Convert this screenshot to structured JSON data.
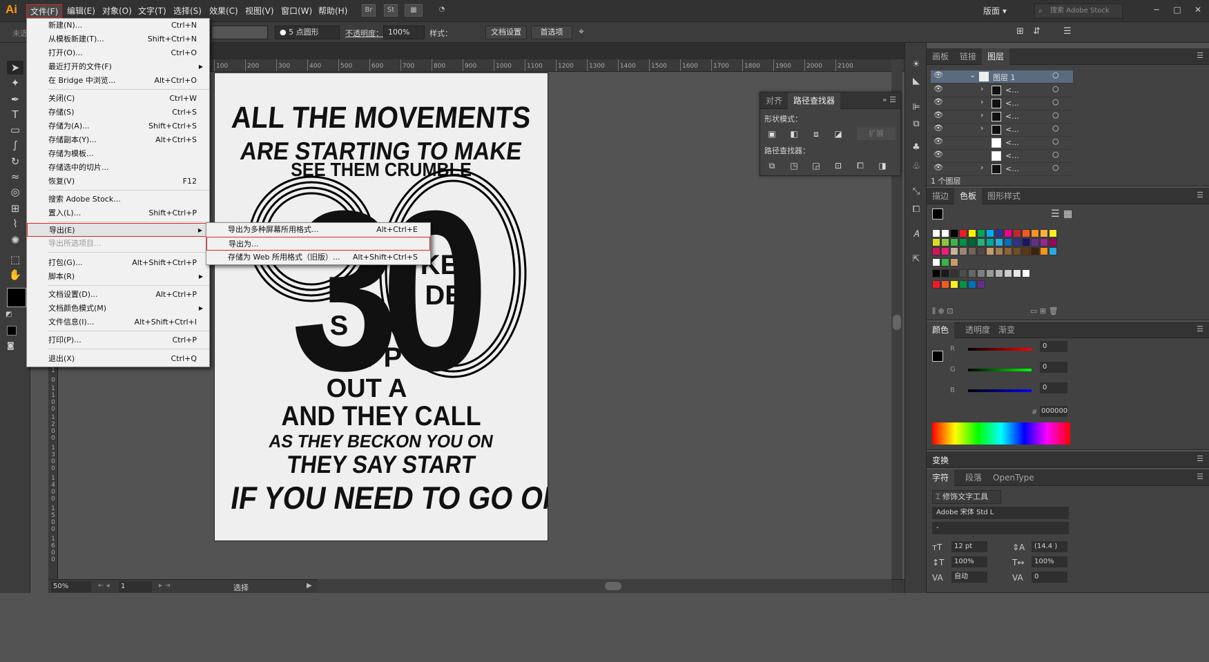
{
  "app": {
    "logo": "Ai"
  },
  "menubar": {
    "items": [
      "文件(F)",
      "编辑(E)",
      "对象(O)",
      "文字(T)",
      "选择(S)",
      "效果(C)",
      "视图(V)",
      "窗口(W)",
      "帮助(H)"
    ],
    "icons": [
      "Br",
      "St",
      "▦",
      "◔"
    ],
    "workspace": "版面",
    "search_placeholder": "搜索 Adobe Stock",
    "window_buttons": [
      "─",
      "□",
      "✕"
    ]
  },
  "controlbar": {
    "selection": "未选",
    "stroke_size": "5 点圆形",
    "opacity_label": "不透明度：",
    "opacity_value": "100%",
    "style_label": "样式：",
    "doc_setup": "文档设置",
    "preferences": "首选项"
  },
  "ruler": {
    "top": [
      "100",
      "200",
      "300",
      "400",
      "500",
      "600",
      "700",
      "800",
      "900",
      "1000",
      "1100",
      "1200",
      "1300",
      "1400",
      "1500",
      "1600",
      "1700",
      "1800",
      "1900",
      "2000",
      "2100"
    ],
    "left": [
      "1",
      "0",
      "0",
      "0",
      "1",
      "1",
      "0",
      "0",
      "1",
      "2",
      "0",
      "0",
      "1",
      "3",
      "0",
      "0",
      "1",
      "4",
      "0",
      "0",
      "1",
      "5",
      "0",
      "0",
      "1",
      "6",
      "0",
      "0"
    ]
  },
  "file_menu": {
    "items": [
      {
        "label": "新建(N)...",
        "shortcut": "Ctrl+N"
      },
      {
        "label": "从模板新建(T)...",
        "shortcut": "Shift+Ctrl+N"
      },
      {
        "label": "打开(O)...",
        "shortcut": "Ctrl+O"
      },
      {
        "label": "最近打开的文件(F)",
        "shortcut": ""
      },
      {
        "label": "在 Bridge 中浏览...",
        "shortcut": "Alt+Ctrl+O"
      },
      {
        "label": "关闭(C)",
        "shortcut": "Ctrl+W"
      },
      {
        "label": "存储(S)",
        "shortcut": "Ctrl+S"
      },
      {
        "label": "存储为(A)...",
        "shortcut": "Shift+Ctrl+S"
      },
      {
        "label": "存储副本(Y)...",
        "shortcut": "Alt+Ctrl+S"
      },
      {
        "label": "存储为模板...",
        "shortcut": ""
      },
      {
        "label": "存储选中的切片...",
        "shortcut": ""
      },
      {
        "label": "恢复(V)",
        "shortcut": "F12"
      },
      {
        "label": "搜索 Adobe Stock...",
        "shortcut": ""
      },
      {
        "label": "置入(L)...",
        "shortcut": "Shift+Ctrl+P"
      },
      {
        "label": "导出(E)",
        "shortcut": ""
      },
      {
        "label": "导出所选项目...",
        "shortcut": ""
      },
      {
        "label": "打包(G)...",
        "shortcut": "Alt+Shift+Ctrl+P"
      },
      {
        "label": "脚本(R)",
        "shortcut": ""
      },
      {
        "label": "文档设置(D)...",
        "shortcut": "Alt+Ctrl+P"
      },
      {
        "label": "文档颜色模式(M)",
        "shortcut": ""
      },
      {
        "label": "文件信息(I)...",
        "shortcut": "Alt+Shift+Ctrl+I"
      },
      {
        "label": "打印(P)...",
        "shortcut": "Ctrl+P"
      },
      {
        "label": "退出(X)",
        "shortcut": "Ctrl+Q"
      }
    ]
  },
  "export_menu": {
    "items": [
      {
        "label": "导出为多种屏幕所用格式...",
        "shortcut": "Alt+Ctrl+E"
      },
      {
        "label": "导出为...",
        "shortcut": ""
      },
      {
        "label": "存储为 Web 所用格式（旧版）...",
        "shortcut": "Alt+Shift+Ctrl+S"
      }
    ]
  },
  "poster": {
    "lines": [
      "ALL THE MOVEMENTS",
      "ARE STARTING TO MAKE",
      "SEE THEM CRUMBLE",
      "30",
      "AND THEY CALL",
      "AS THEY BECKON YOU ON",
      "THEY SAY START",
      "IF YOU NEED TO GO ON"
    ],
    "fragments": [
      "KES",
      "DE",
      "S",
      "APP",
      "OUT A"
    ]
  },
  "pathfinder": {
    "tabs": [
      "对齐",
      "路径查找器"
    ],
    "shape_modes": "形状模式：",
    "expand": "扩展",
    "pathfinders": "路径查找器："
  },
  "layers_panel": {
    "tabs": [
      "画板",
      "链接",
      "图层"
    ],
    "layer_name": "图层 1",
    "sublayers": [
      "<...",
      "<...",
      "<...",
      "<...",
      "<...",
      "<...",
      "<..."
    ],
    "footer": "1 个图层"
  },
  "swatches_panel": {
    "tabs": [
      "描边",
      "色板",
      "图形样式"
    ]
  },
  "color_panel": {
    "tabs": [
      "颜色",
      "透明度",
      "渐变"
    ],
    "channels": [
      {
        "label": "R",
        "value": "0"
      },
      {
        "label": "G",
        "value": "0"
      },
      {
        "label": "B",
        "value": "0"
      }
    ],
    "hex": "000000"
  },
  "transform_panel": {
    "title": "变换"
  },
  "char_panel": {
    "tabs": [
      "字符",
      "段落",
      "OpenType"
    ],
    "touch_tool": "修饰文字工具",
    "font": "Adobe 宋体 Std L",
    "style": "-",
    "size": "12 pt",
    "leading": "(14.4 )",
    "v_scale": "100%",
    "h_scale": "100%",
    "kerning": "自动",
    "tracking": "0"
  },
  "statusbar": {
    "zoom": "50%",
    "artboard": "1",
    "tool": "选择"
  }
}
